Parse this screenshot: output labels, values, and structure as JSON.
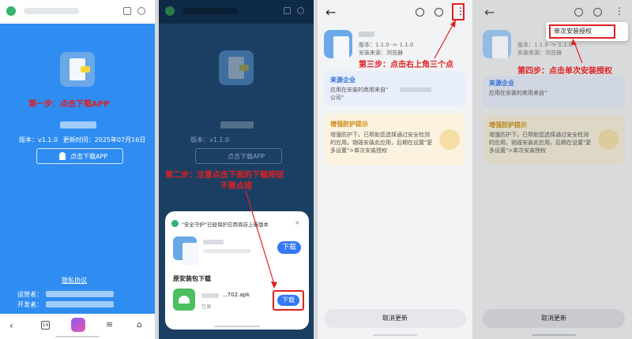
{
  "panel1": {
    "step1": "第一步：点击下载APP",
    "version": "版本：v1.1.0",
    "update_time": "更新时间：2025年07月16日",
    "download_button": "点击下载APP",
    "privacy_link": "隐私协议",
    "operator_label": "运营者：",
    "developer_label": "开发者：",
    "nav_tabs_count": "14"
  },
  "panel2": {
    "version": "版本：v1.1.0",
    "download_button": "点击下载APP",
    "step2": "第二步：注意点击下面的下载按钮",
    "step2b": "不要点错",
    "sheet_title": "\"安全守护\"已经保护应用商店上新版本",
    "download_btn_1": "下载",
    "section_title": "原安装包下载",
    "file_name": "...702.apk",
    "file_sub": "已保",
    "download_btn_2": "下载"
  },
  "panel3": {
    "version_line": "版本：1.1.0 -> 1.1.0",
    "source_line": "安装来源：浏览器",
    "step3": "第三步：点击右上角三个点",
    "source_title": "来源企业",
    "source_desc": "应用在安装的商用来自\"",
    "source_desc2": "公司\"",
    "protect_title": "增强防护提示",
    "protect_desc": "增强防护下，已帮助您选择通过安全检测的应用。销毁安装此应用，后期在设置\"更多设置\">单次安装授权",
    "cancel_update": "取消更新"
  },
  "panel4": {
    "menu_item": "单次安装授权",
    "step4": "第四步：点击单次安装授权",
    "version_line": "版本：1.1.0 -> 1.1.0",
    "source_line": "安装来源：浏览器",
    "source_title": "来源企业",
    "source_desc": "应用在安装的商用来自\"",
    "protect_title": "增强防护提示",
    "protect_desc": "增强防护下，已帮助您选择通过安全检测的应用。销毁安装此应用，后期在设置\"更多设置\">单次安装授权",
    "cancel_update": "取消更新"
  }
}
